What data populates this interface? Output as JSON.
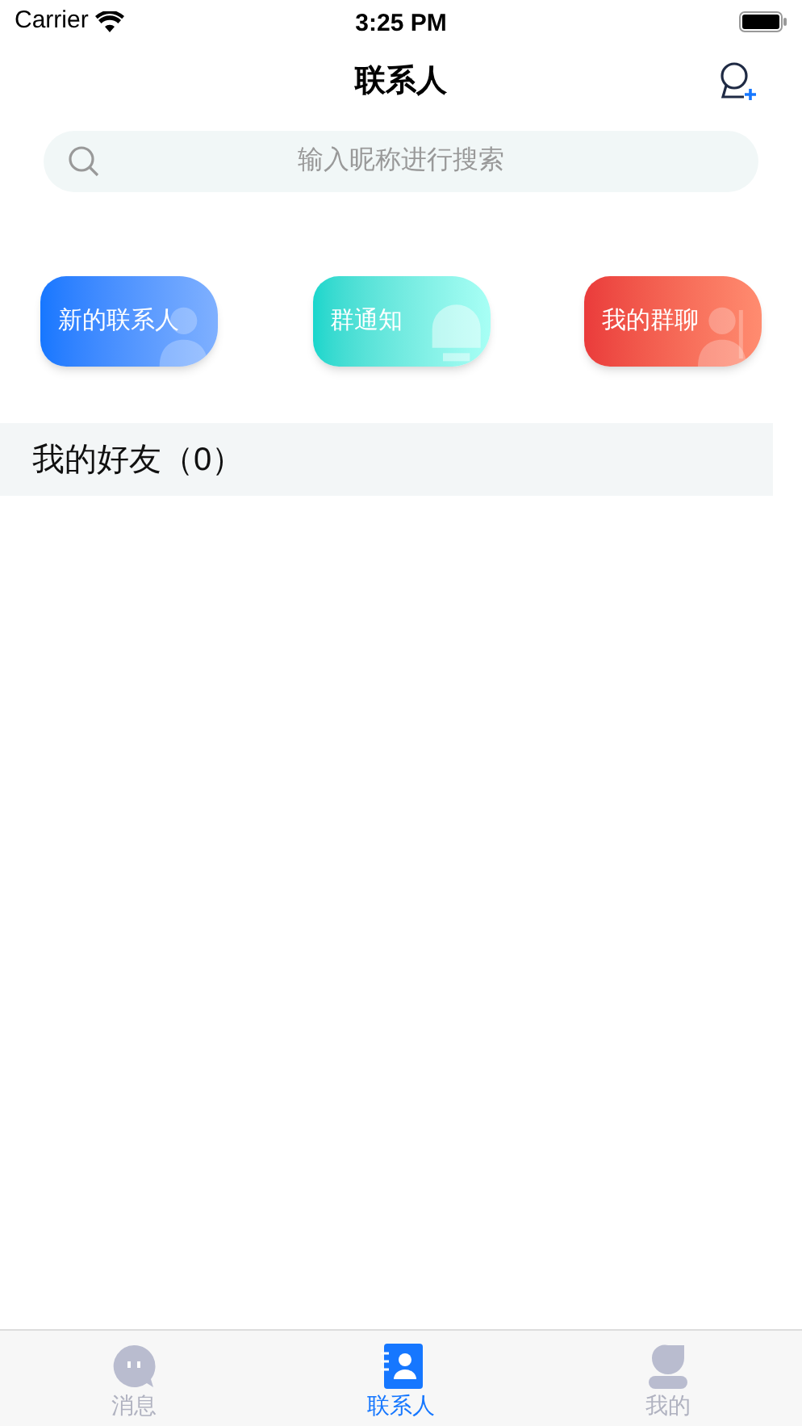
{
  "status_bar": {
    "carrier": "Carrier",
    "time": "3:25 PM"
  },
  "nav": {
    "title": "联系人"
  },
  "search": {
    "placeholder": "输入昵称进行搜索"
  },
  "shortcuts": [
    {
      "label": "新的联系人",
      "kind": "new-contact"
    },
    {
      "label": "群通知",
      "kind": "group-notice"
    },
    {
      "label": "我的群聊",
      "kind": "group-chat"
    }
  ],
  "friends_header": {
    "label": "我的好友（0）"
  },
  "tab_bar": [
    {
      "label": "消息",
      "kind": "messages",
      "selected": false
    },
    {
      "label": "联系人",
      "kind": "contacts",
      "selected": true
    },
    {
      "label": "我的",
      "kind": "me",
      "selected": false
    }
  ]
}
